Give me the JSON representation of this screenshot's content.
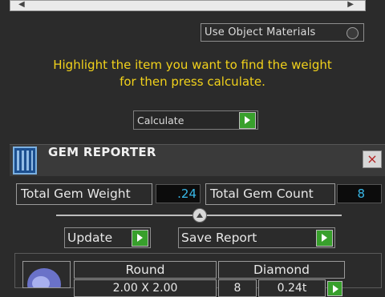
{
  "material_options": {
    "use_object_materials_label": "Use Object Materials"
  },
  "instruction": {
    "line1": "Highlight the item you want to find the weight",
    "line2": "for then press calculate."
  },
  "calculate": {
    "label": "Calculate"
  },
  "gem_reporter": {
    "title": "GEM REPORTER",
    "close_glyph": "×",
    "total_weight_label": "Total Gem Weight",
    "total_weight_value": ".24",
    "total_count_label": "Total Gem Count",
    "total_count_value": "8",
    "update_label": "Update",
    "save_report_label": "Save Report",
    "table": {
      "headers": [
        "Round",
        "Diamond"
      ],
      "rows": [
        {
          "size": "2.00 X 2.00",
          "qty": "8",
          "weight": "0.24t"
        }
      ]
    }
  },
  "colors": {
    "instruction_text": "#f2d21b",
    "value_text": "#38b8e8",
    "go_button": "#38a02c"
  }
}
